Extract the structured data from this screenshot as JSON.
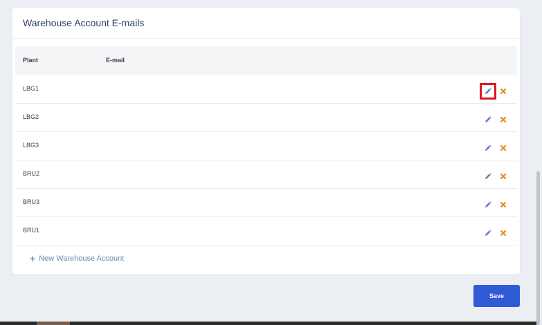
{
  "card": {
    "title": "Warehouse Account E-mails"
  },
  "table": {
    "headers": {
      "plant": "Plant",
      "email": "E-mail"
    },
    "rows": [
      {
        "plant": "LBG1",
        "email": ""
      },
      {
        "plant": "LBG2",
        "email": ""
      },
      {
        "plant": "LBG3",
        "email": ""
      },
      {
        "plant": "BRU2",
        "email": ""
      },
      {
        "plant": "BRU3",
        "email": ""
      },
      {
        "plant": "BRU1",
        "email": ""
      }
    ]
  },
  "actions": {
    "new_label": "New Warehouse Account",
    "save_label": "Save"
  },
  "icons": {
    "edit": "pencil-icon",
    "delete": "close-icon",
    "add": "plus-icon"
  },
  "colors": {
    "edit_icon": "#5b7fbd",
    "delete_icon": "#e08a1a",
    "primary": "#2f5bd5",
    "highlight": "#e0161e"
  }
}
